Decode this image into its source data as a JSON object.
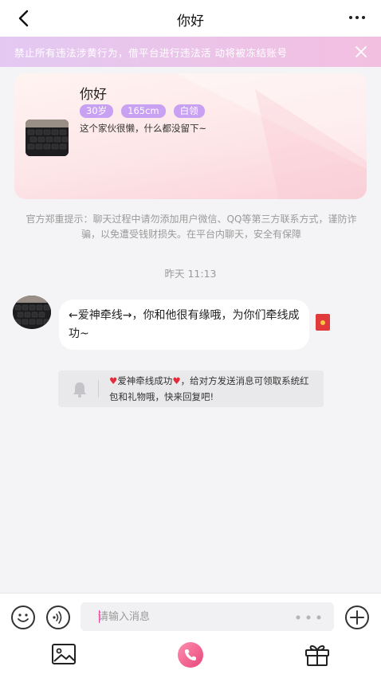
{
  "nav": {
    "title": "你好"
  },
  "notice": {
    "text": "禁止所有违法涉黄行为，借平台进行违法活 动将被冻结账号"
  },
  "profile": {
    "name": "你好",
    "tags": [
      "30岁",
      "165cm",
      "白领"
    ],
    "bio": "这个家伙很懒，什么都没留下~"
  },
  "warning_text": "官方郑重提示：聊天过程中请勿添加用户微信、QQ等第三方联系方式，谨防诈骗，以免遭受钱财损失。在平台内聊天，安全有保障",
  "timestamp": "昨天 11:13",
  "message": {
    "text": "←爱神牵线→，你和他很有缘哦，为你们牵线成功~"
  },
  "system_notice": {
    "highlight": "爱神牵线成功",
    "text": "，给对方发送消息可领取系统红包和礼物哦，快来回复吧!"
  },
  "input": {
    "placeholder": "请输入消息"
  },
  "colors": {
    "accent_pink": "#e8467a",
    "tag_purple": "#c9a1f2",
    "notice_gradient_start": "#e3c9f2",
    "notice_gradient_end": "#f3bfe0",
    "heart_red": "#e22b3c"
  },
  "icons": {
    "back": "chevron-left-icon",
    "more": "ellipsis-icon",
    "close": "close-icon",
    "bell": "bell-icon",
    "emoji": "emoji-icon",
    "voice": "voice-icon",
    "plus": "plus-icon",
    "image": "image-icon",
    "call": "phone-icon",
    "gift": "gift-icon",
    "red_packet": "red-packet-icon"
  }
}
